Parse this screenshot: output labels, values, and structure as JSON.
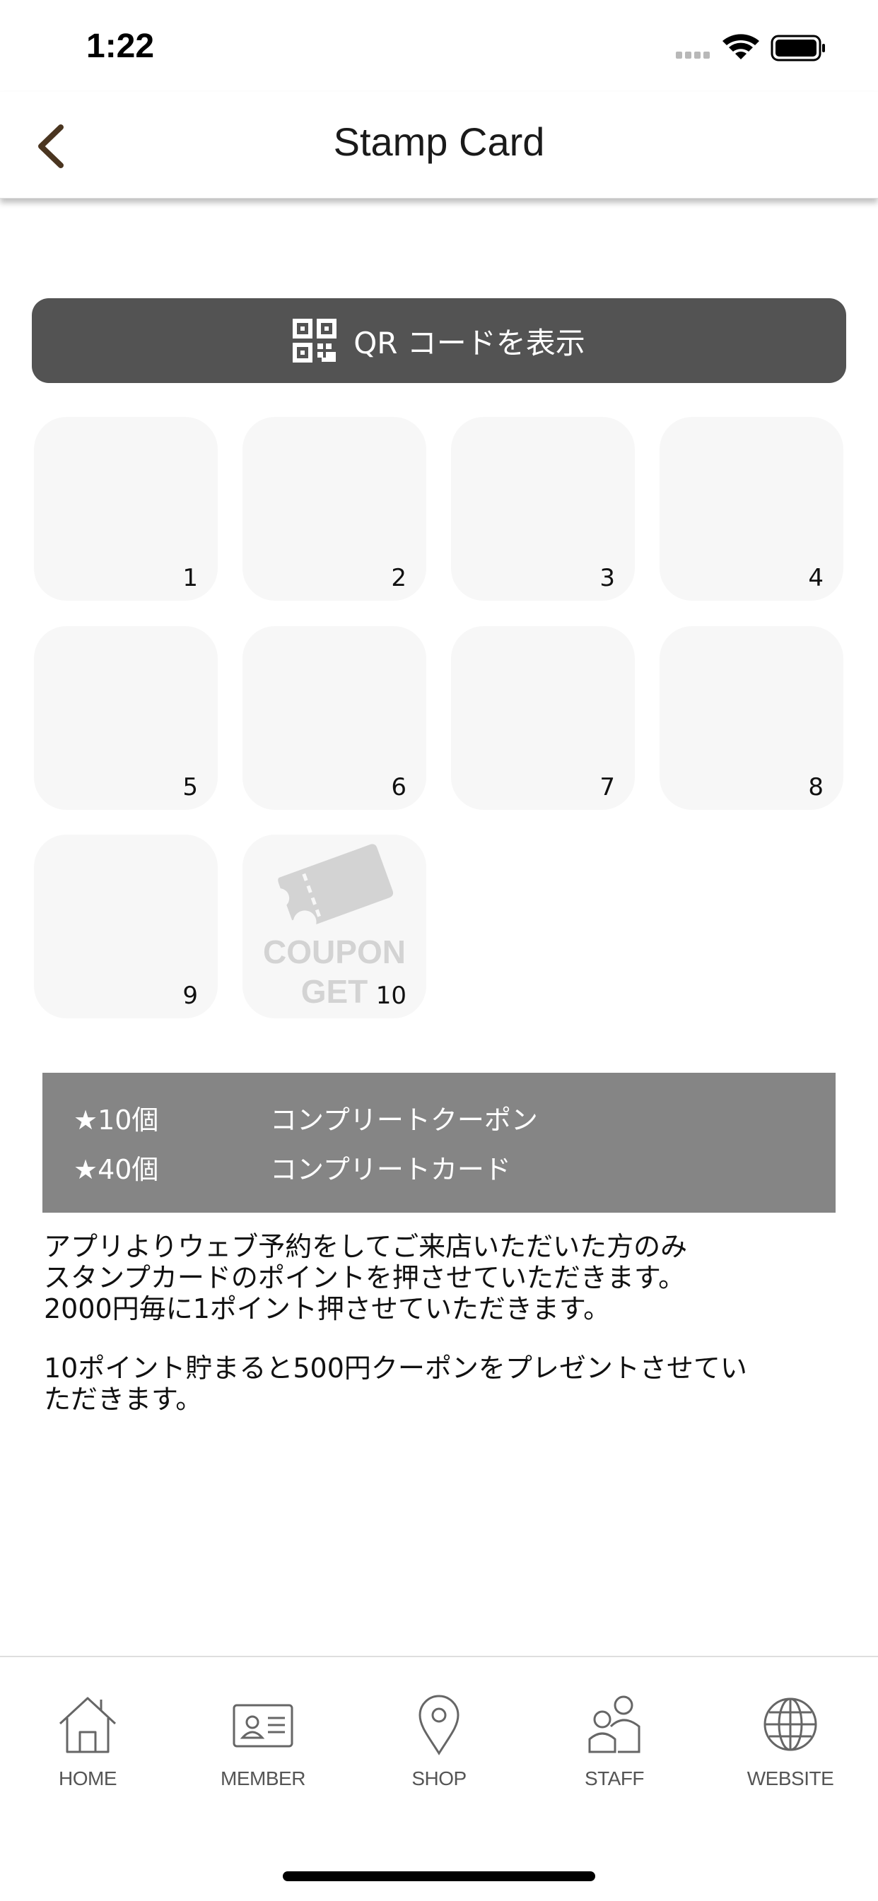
{
  "status_bar": {
    "time": "1:22"
  },
  "nav": {
    "title": "Stamp Card",
    "back_icon": "chevron-left-icon"
  },
  "qr_button": {
    "label": "QR コードを表示",
    "icon": "qr-code-icon"
  },
  "stamps": [
    {
      "number": "1"
    },
    {
      "number": "2"
    },
    {
      "number": "3"
    },
    {
      "number": "4"
    },
    {
      "number": "5"
    },
    {
      "number": "6"
    },
    {
      "number": "7"
    },
    {
      "number": "8"
    },
    {
      "number": "9"
    },
    {
      "number": "10",
      "coupon_line1": "COUPON",
      "coupon_line2": "GET"
    }
  ],
  "rewards": [
    {
      "count": "★10個",
      "reward": "コンプリートクーポン"
    },
    {
      "count": "★40個",
      "reward": "コンプリートカード"
    }
  ],
  "description": {
    "line1": "アプリよりウェブ予約をしてご来店いただいた方のみ",
    "line2": "スタンプカードのポイントを押させていただきます。",
    "line3": "2000円毎に1ポイント押させていただきます。",
    "line4": "10ポイント貯まると500円クーポンをプレゼントさせてい",
    "line5": "ただきます。"
  },
  "tabs": [
    {
      "label": "HOME",
      "icon": "home-icon"
    },
    {
      "label": "MEMBER",
      "icon": "member-card-icon"
    },
    {
      "label": "SHOP",
      "icon": "location-pin-icon"
    },
    {
      "label": "STAFF",
      "icon": "staff-icon"
    },
    {
      "label": "WEBSITE",
      "icon": "globe-icon"
    }
  ],
  "colors": {
    "qr_button_bg": "#535353",
    "reward_box_bg": "#858585",
    "stamp_bg": "#f7f7f7",
    "back_arrow": "#4a3520"
  }
}
